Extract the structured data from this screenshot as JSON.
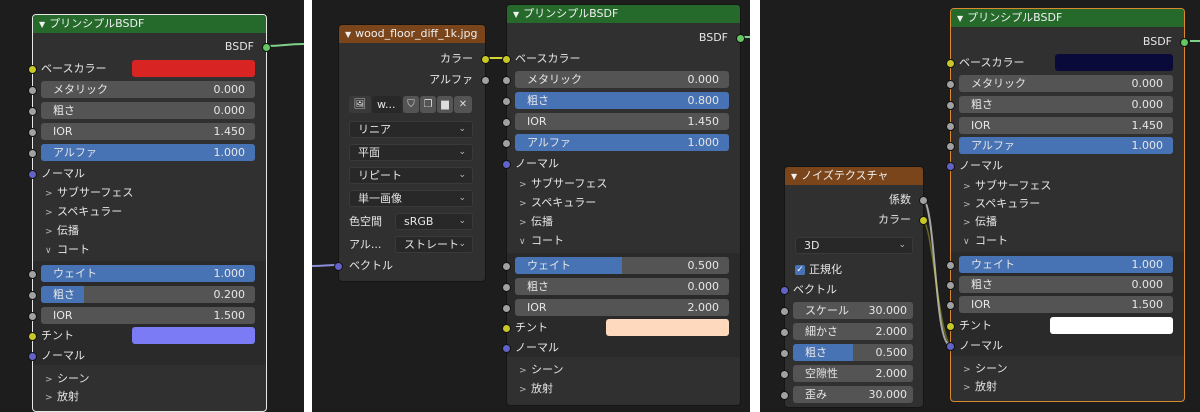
{
  "panels": [
    {
      "bsdf": {
        "title": "プリンシプルBSDF",
        "out": "BSDF",
        "base_color_label": "ベースカラー",
        "base_color": "#d92424",
        "metallic": {
          "label": "メタリック",
          "value": "0.000",
          "fill": 0
        },
        "roughness": {
          "label": "粗さ",
          "value": "0.000",
          "fill": 0
        },
        "ior": {
          "label": "IOR",
          "value": "1.450",
          "fill": 0
        },
        "alpha": {
          "label": "アルファ",
          "value": "1.000",
          "fill": 1
        },
        "normal": "ノーマル",
        "subsurface": "サブサーフェス",
        "specular": "スペキュラー",
        "transmission": "伝播",
        "coat": "コート",
        "coat_weight": {
          "label": "ウェイト",
          "value": "1.000",
          "fill": 1
        },
        "coat_roughness": {
          "label": "粗さ",
          "value": "0.200",
          "fill": 0.2
        },
        "coat_ior": {
          "label": "IOR",
          "value": "1.500",
          "fill": 0
        },
        "tint_label": "チント",
        "tint": "#7b7bf5",
        "coat_normal": "ノーマル",
        "sheen": "シーン",
        "emission": "放射"
      }
    },
    {
      "image": {
        "title": "wood_floor_diff_1k.jpg",
        "out_color": "カラー",
        "out_alpha": "アルファ",
        "image_name": "w...",
        "interpolation": "リニア",
        "projection": "平面",
        "extension": "リピート",
        "source": "単一画像",
        "colorspace_label": "色空間",
        "colorspace": "sRGB",
        "alpha_label": "アル...",
        "alpha_mode": "ストレート",
        "vector": "ベクトル"
      },
      "bsdf": {
        "title": "プリンシプルBSDF",
        "out": "BSDF",
        "base_color_label": "ベースカラー",
        "metallic": {
          "label": "メタリック",
          "value": "0.000",
          "fill": 0
        },
        "roughness": {
          "label": "粗さ",
          "value": "0.800",
          "fill": 1
        },
        "ior": {
          "label": "IOR",
          "value": "1.450",
          "fill": 0
        },
        "alpha": {
          "label": "アルファ",
          "value": "1.000",
          "fill": 1
        },
        "normal": "ノーマル",
        "subsurface": "サブサーフェス",
        "specular": "スペキュラー",
        "transmission": "伝播",
        "coat": "コート",
        "coat_weight": {
          "label": "ウェイト",
          "value": "0.500",
          "fill": 0.5
        },
        "coat_roughness": {
          "label": "粗さ",
          "value": "0.000",
          "fill": 0
        },
        "coat_ior": {
          "label": "IOR",
          "value": "2.000",
          "fill": 0
        },
        "tint_label": "チント",
        "tint": "#ffd9bd",
        "coat_normal": "ノーマル",
        "sheen": "シーン",
        "emission": "放射"
      }
    },
    {
      "noise": {
        "title": "ノイズテクスチャ",
        "out_fac": "係数",
        "out_color": "カラー",
        "dimensions": "3D",
        "normalize": "正規化",
        "vector": "ベクトル",
        "scale": {
          "label": "スケール",
          "value": "30.000",
          "fill": 0
        },
        "detail": {
          "label": "細かさ",
          "value": "2.000",
          "fill": 0
        },
        "roughness": {
          "label": "粗さ",
          "value": "0.500",
          "fill": 0.5
        },
        "lacunarity": {
          "label": "空隙性",
          "value": "2.000",
          "fill": 0
        },
        "distortion": {
          "label": "歪み",
          "value": "30.000",
          "fill": 0
        }
      },
      "bsdf": {
        "title": "プリンシプルBSDF",
        "out": "BSDF",
        "base_color_label": "ベースカラー",
        "base_color": "#0a0a3a",
        "metallic": {
          "label": "メタリック",
          "value": "0.000",
          "fill": 0
        },
        "roughness": {
          "label": "粗さ",
          "value": "0.000",
          "fill": 0
        },
        "ior": {
          "label": "IOR",
          "value": "1.450",
          "fill": 0
        },
        "alpha": {
          "label": "アルファ",
          "value": "1.000",
          "fill": 1
        },
        "normal": "ノーマル",
        "subsurface": "サブサーフェス",
        "specular": "スペキュラー",
        "transmission": "伝播",
        "coat": "コート",
        "coat_weight": {
          "label": "ウェイト",
          "value": "1.000",
          "fill": 1
        },
        "coat_roughness": {
          "label": "粗さ",
          "value": "0.000",
          "fill": 0
        },
        "coat_ior": {
          "label": "IOR",
          "value": "1.500",
          "fill": 0
        },
        "tint_label": "チント",
        "tint": "#ffffff",
        "coat_normal": "ノーマル",
        "sheen": "シーン",
        "emission": "放射"
      }
    }
  ]
}
